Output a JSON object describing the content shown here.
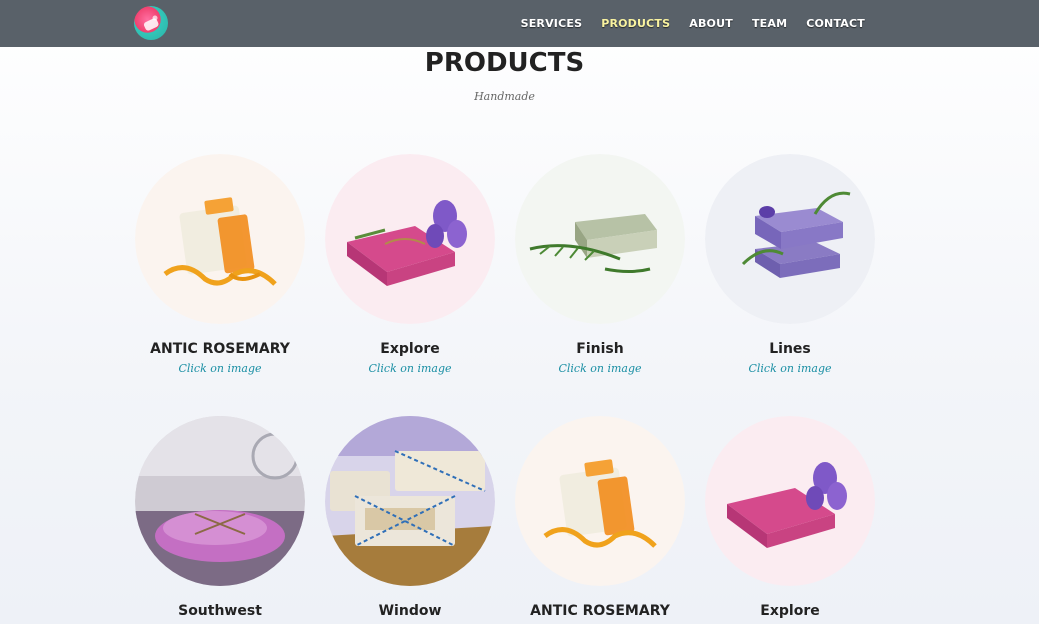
{
  "nav": {
    "links": [
      {
        "label": "SERVICES",
        "active": false
      },
      {
        "label": "PRODUCTS",
        "active": true
      },
      {
        "label": "ABOUT",
        "active": false
      },
      {
        "label": "TEAM",
        "active": false
      },
      {
        "label": "CONTACT",
        "active": false
      }
    ]
  },
  "section": {
    "title": "PRODUCTS",
    "subtitle": "Handmade"
  },
  "products": [
    {
      "name": "ANTIC ROSEMARY",
      "link": "Click on image",
      "bg": "#fbf4ef",
      "image": "orange-soap-with-calendula"
    },
    {
      "name": "Explore",
      "link": "Click on image",
      "bg": "#fbecf1",
      "image": "pink-soap-with-lavender"
    },
    {
      "name": "Finish",
      "link": "Click on image",
      "bg": "#f3f6f2",
      "image": "green-soap-with-rosemary"
    },
    {
      "name": "Lines",
      "link": "Click on image",
      "bg": "#eef0f5",
      "image": "purple-soap-stack-with-lavender"
    },
    {
      "name": "Southwest",
      "link": "",
      "bg": "#cfcbd3",
      "image": "pink-soap-on-lavender-photo"
    },
    {
      "name": "Window",
      "link": "",
      "bg": "#d8d4ea",
      "image": "wrapped-soap-bars-photo"
    },
    {
      "name": "ANTIC ROSEMARY",
      "link": "",
      "bg": "#fbf4ef",
      "image": "orange-soap-with-calendula"
    },
    {
      "name": "Explore",
      "link": "",
      "bg": "#fbecf1",
      "image": "pink-soap-with-lavender"
    }
  ],
  "colors": {
    "navbar": "#596169",
    "nav_active": "#f9f3a0",
    "link": "#1a8fa4"
  }
}
